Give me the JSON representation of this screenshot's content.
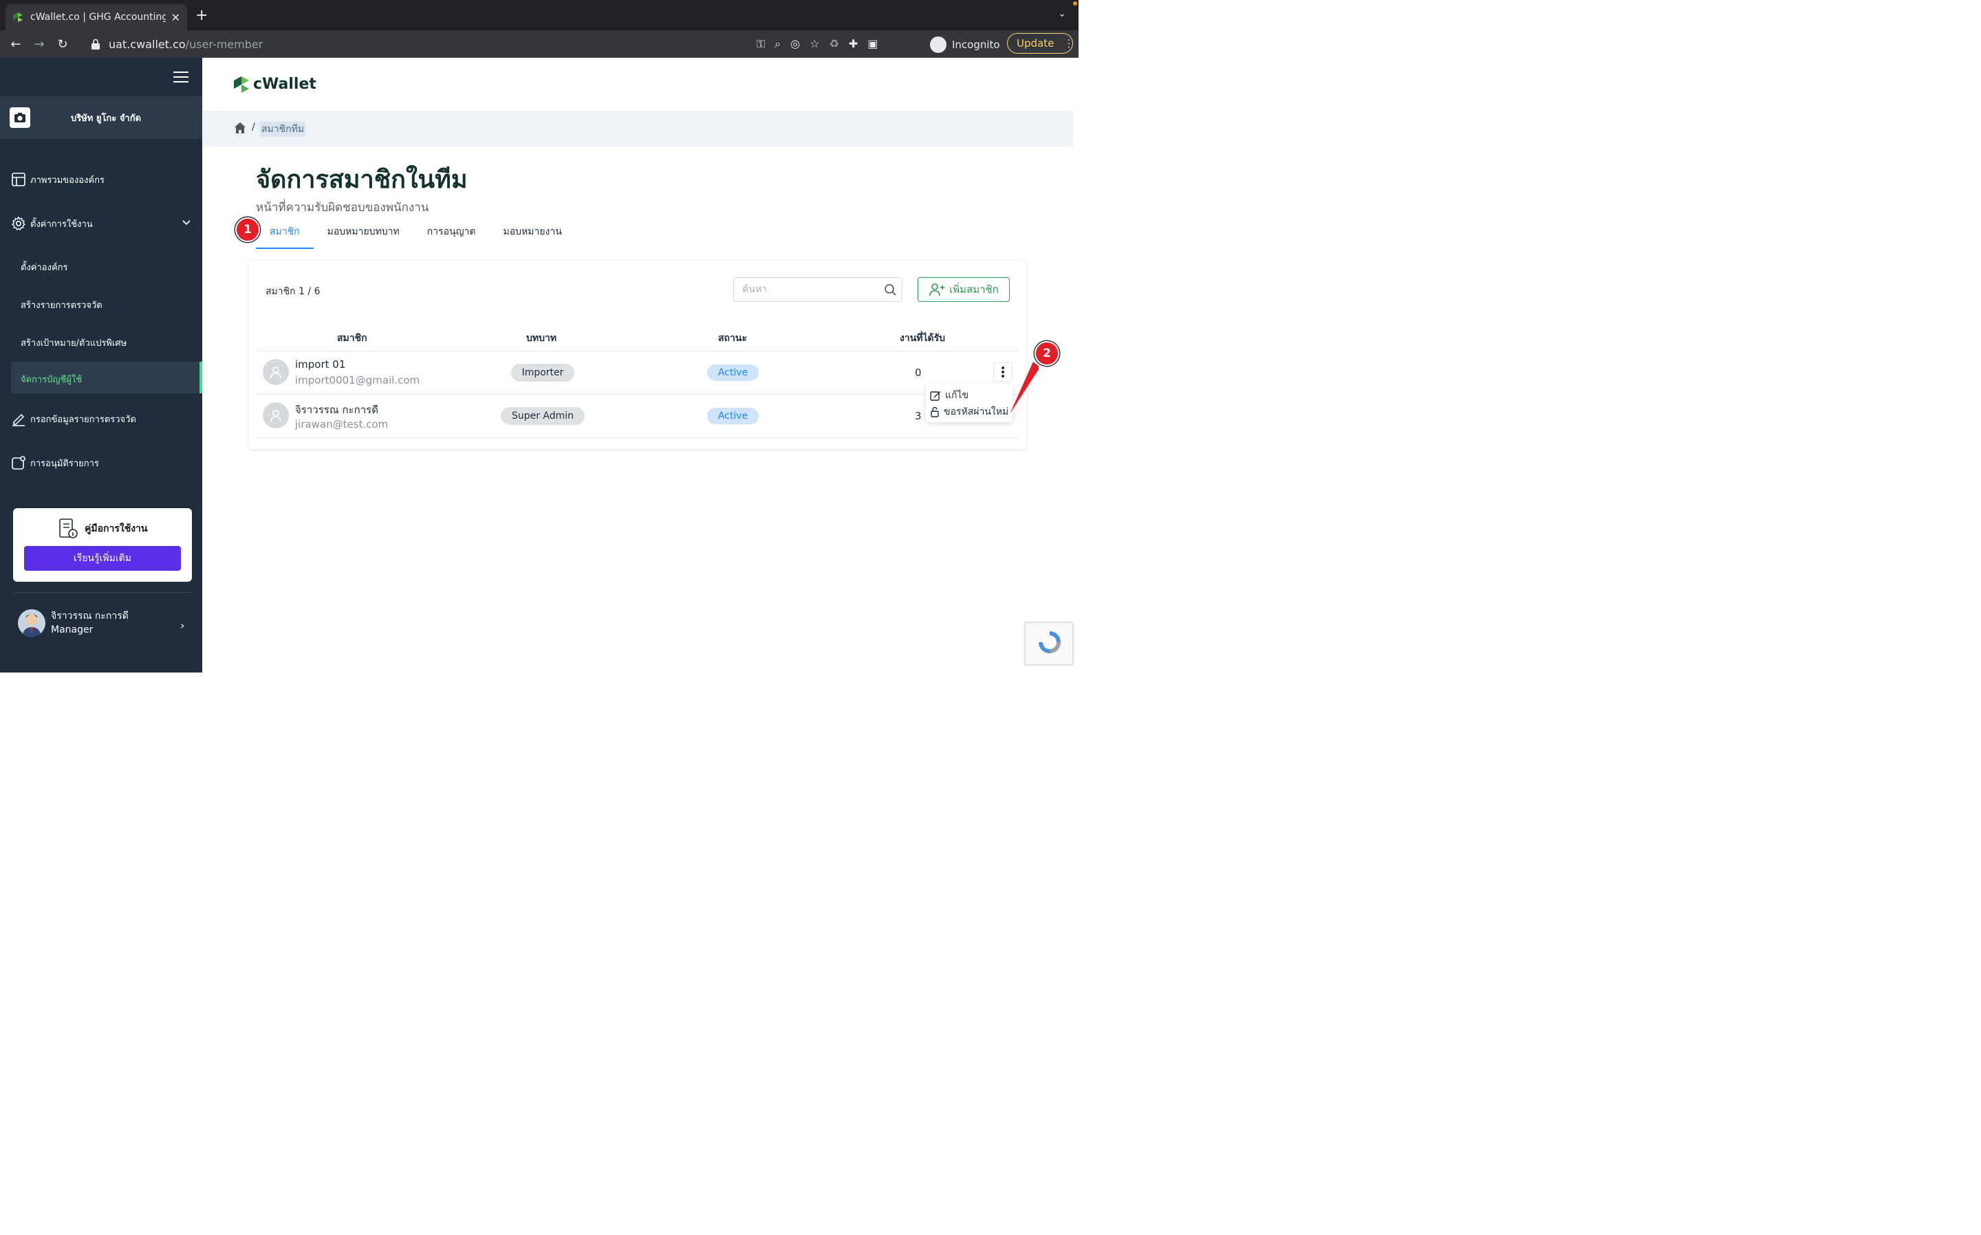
{
  "browser": {
    "tab_title": "cWallet.co | GHG Accounting S",
    "url_host": "uat.cwallet.co",
    "url_path": "/user-member",
    "incognito_label": "Incognito",
    "update_label": "Update"
  },
  "sidebar": {
    "company_name": "บริษัท ยูโกะ จำกัด",
    "items": [
      {
        "label": "ภาพรวมขององค์กร",
        "icon": "layout-icon"
      },
      {
        "label": "ตั้งค่าการใช้งาน",
        "icon": "gear-icon"
      },
      {
        "label": "ตั้งค่าองค์กร"
      },
      {
        "label": "สร้างรายการตรวจวัด"
      },
      {
        "label": "สร้างเป้าหมาย/ตัวแปรพิเศษ"
      },
      {
        "label": "จัดการบัญชีผู้ใช้"
      },
      {
        "label": "กรอกข้อมูลรายการตรวจวัด",
        "icon": "pen-icon"
      },
      {
        "label": "การอนุมัติรายการ",
        "icon": "approval-icon"
      }
    ],
    "manual_title": "คู่มือการใช้งาน",
    "manual_button": "เรียนรู้เพิ่มเติม",
    "user_name": "จิราวรรณ กะการดี",
    "user_role": "Manager"
  },
  "main": {
    "logo_text": "cWallet",
    "breadcrumb_sep": "/",
    "breadcrumb_current": "สมาชิกทีม",
    "title": "จัดการสมาชิกในทีม",
    "subtitle": "หน้าที่ความรับผิดชอบของพนักงาน",
    "tabs": [
      "สมาชิก",
      "มอบหมายบทบาท",
      "การอนุญาต",
      "มอบหมายงาน"
    ],
    "member_count": "สมาชิก 1 / 6",
    "search_placeholder": "ค้นหา",
    "add_member_label": "เพิ่มสมาชิก",
    "columns": [
      "สมาชิก",
      "บทบาท",
      "สถานะ",
      "งานที่ได้รับ"
    ],
    "rows": [
      {
        "name": "import 01",
        "email": "import0001@gmail.com",
        "role": "Importer",
        "status": "Active",
        "tasks": "0"
      },
      {
        "name": "จิราวรรณ กะการดี",
        "email": "jirawan@test.com",
        "role": "Super Admin",
        "status": "Active",
        "tasks": "3"
      }
    ],
    "dropdown": [
      "แก้ไข",
      "ขอรหัสผ่านใหม่"
    ],
    "callouts": [
      "1",
      "2"
    ]
  },
  "colors": {
    "sidebar_bg": "#1f2d3d",
    "accent_blue": "#1f87ff",
    "accent_green": "#2a9a4a",
    "cta_purple": "#5b2ee8",
    "callout_red": "#e41e26"
  }
}
